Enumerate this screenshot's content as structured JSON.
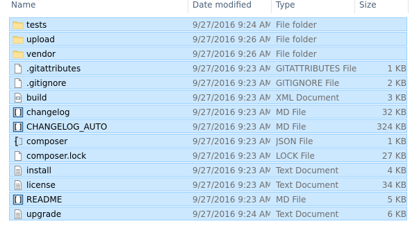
{
  "columns": {
    "name": "Name",
    "date_modified": "Date modified",
    "type": "Type",
    "size": "Size"
  },
  "files": [
    {
      "name": "tests",
      "date": "9/27/2016 9:24 AM",
      "type": "File folder",
      "size": "",
      "icon": "folder-icon"
    },
    {
      "name": "upload",
      "date": "9/27/2016 9:26 AM",
      "type": "File folder",
      "size": "",
      "icon": "folder-icon"
    },
    {
      "name": "vendor",
      "date": "9/27/2016 9:26 AM",
      "type": "File folder",
      "size": "",
      "icon": "folder-icon"
    },
    {
      "name": ".gitattributes",
      "date": "9/27/2016 9:23 AM",
      "type": "GITATTRIBUTES File",
      "size": "1 KB",
      "icon": "blank-file-icon"
    },
    {
      "name": ".gitignore",
      "date": "9/27/2016 9:23 AM",
      "type": "GITIGNORE File",
      "size": "2 KB",
      "icon": "blank-file-icon"
    },
    {
      "name": "build",
      "date": "9/27/2016 9:23 AM",
      "type": "XML Document",
      "size": "3 KB",
      "icon": "xml-file-icon"
    },
    {
      "name": "changelog",
      "date": "9/27/2016 9:23 AM",
      "type": "MD File",
      "size": "32 KB",
      "icon": "md-file-icon"
    },
    {
      "name": "CHANGELOG_AUTO",
      "date": "9/27/2016 9:23 AM",
      "type": "MD File",
      "size": "324 KB",
      "icon": "md-file-icon"
    },
    {
      "name": "composer",
      "date": "9/27/2016 9:23 AM",
      "type": "JSON File",
      "size": "1 KB",
      "icon": "json-file-icon"
    },
    {
      "name": "composer.lock",
      "date": "9/27/2016 9:23 AM",
      "type": "LOCK File",
      "size": "27 KB",
      "icon": "blank-file-icon"
    },
    {
      "name": "install",
      "date": "9/27/2016 9:23 AM",
      "type": "Text Document",
      "size": "4 KB",
      "icon": "text-file-icon"
    },
    {
      "name": "license",
      "date": "9/27/2016 9:23 AM",
      "type": "Text Document",
      "size": "34 KB",
      "icon": "text-file-icon"
    },
    {
      "name": "README",
      "date": "9/27/2016 9:23 AM",
      "type": "MD File",
      "size": "5 KB",
      "icon": "md-file-icon"
    },
    {
      "name": "upgrade",
      "date": "9/27/2016 9:24 AM",
      "type": "Text Document",
      "size": "6 KB",
      "icon": "text-file-icon"
    }
  ],
  "colors": {
    "selection_fill": "#cce8ff",
    "selection_border": "#99d1ff",
    "folder": "#f8d775",
    "md_icon": "#1e5f99"
  }
}
